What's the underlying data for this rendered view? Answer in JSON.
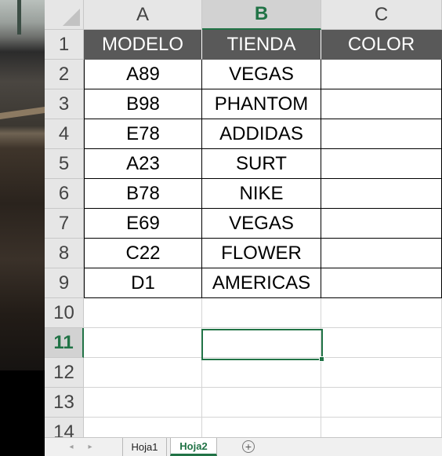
{
  "spreadsheet": {
    "columns": [
      "A",
      "B",
      "C"
    ],
    "selected_column": "B",
    "rows": [
      "1",
      "2",
      "3",
      "4",
      "5",
      "6",
      "7",
      "8",
      "9",
      "10",
      "11",
      "12",
      "13",
      "14"
    ],
    "selected_row": "11",
    "header_row": [
      "MODELO",
      "TIENDA",
      "COLOR"
    ],
    "data": [
      [
        "A89",
        "VEGAS",
        ""
      ],
      [
        "B98",
        "PHANTOM",
        ""
      ],
      [
        "E78",
        "ADDIDAS",
        ""
      ],
      [
        "A23",
        "SURT",
        ""
      ],
      [
        "B78",
        "NIKE",
        ""
      ],
      [
        "E69",
        "VEGAS",
        ""
      ],
      [
        "C22",
        "FLOWER",
        ""
      ],
      [
        "D1",
        "AMERICAS",
        ""
      ]
    ],
    "active_cell": "B11"
  },
  "sheet_tabs": {
    "prev_icon": "◂",
    "next_icon": "▸",
    "tabs": [
      "Hoja1",
      "Hoja2"
    ],
    "active_tab": "Hoja2",
    "add_icon": "+"
  },
  "colors": {
    "accent": "#217346",
    "header_fill": "#595959",
    "header_text": "#ffffff"
  }
}
